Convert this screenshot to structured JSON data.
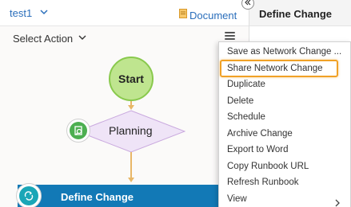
{
  "header": {
    "title": "test1",
    "document_link": "Document"
  },
  "toolbar": {
    "select_action": "Select Action"
  },
  "diagram": {
    "start_label": "Start",
    "planning_label": "Planning",
    "define_change_label": "Define Change"
  },
  "right_panel": {
    "title": "Define Change"
  },
  "menu": {
    "items": [
      {
        "label": "Save as Network Change ..."
      },
      {
        "label": "Share Network Change"
      },
      {
        "label": "Duplicate"
      },
      {
        "label": "Delete"
      },
      {
        "label": "Schedule"
      },
      {
        "label": "Archive Change"
      },
      {
        "label": "Export to Word"
      },
      {
        "label": "Copy Runbook URL"
      },
      {
        "label": "Refresh Runbook"
      },
      {
        "label": "View"
      }
    ],
    "highlighted_index": 1
  },
  "colors": {
    "accent_blue": "#1279b6",
    "link_blue": "#2a6ebb",
    "start_green": "#bfe58f",
    "planning_purple": "#efe4f7",
    "connector_orange": "#e8b768",
    "highlight_orange": "#f0a126"
  }
}
